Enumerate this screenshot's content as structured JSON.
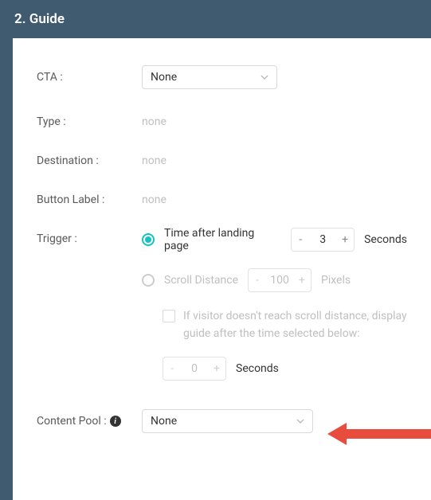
{
  "header": {
    "title": "2. Guide"
  },
  "fields": {
    "cta": {
      "label": "CTA :",
      "value": "None"
    },
    "type": {
      "label": "Type :",
      "value": "none"
    },
    "destination": {
      "label": "Destination :",
      "value": "none"
    },
    "button_label": {
      "label": "Button Label :",
      "value": "none"
    },
    "trigger": {
      "label": "Trigger :",
      "time_option": {
        "label": "Time after landing page",
        "value": "3",
        "unit": "Seconds",
        "selected": true
      },
      "scroll_option": {
        "label": "Scroll Distance",
        "value": "100",
        "unit": "Pixels",
        "selected": false,
        "fallback_text": "If visitor doesn't reach scroll distance, display guide after the time selected below:",
        "fallback_value": "0",
        "fallback_unit": "Seconds"
      }
    },
    "content_pool": {
      "label": "Content Pool :",
      "value": "None"
    }
  },
  "glyphs": {
    "minus": "-",
    "plus": "+",
    "info": "i"
  }
}
